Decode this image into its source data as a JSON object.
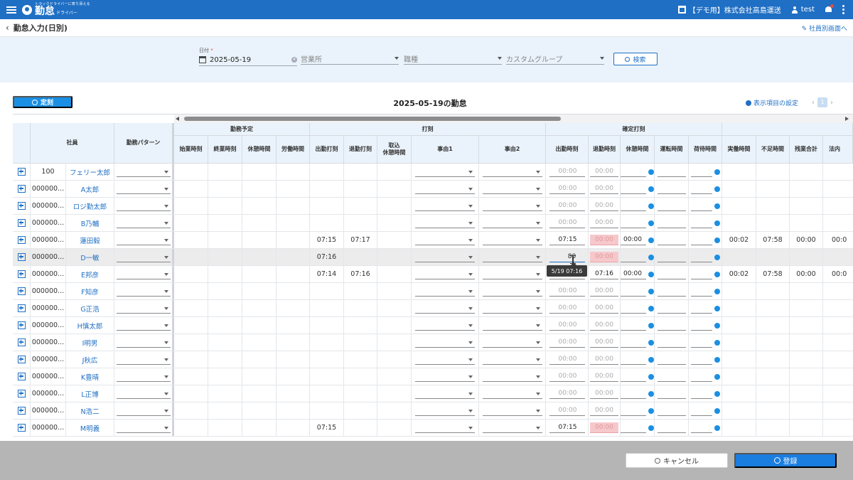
{
  "header": {
    "logo_tagline": "トラックドライバーに寄り添える",
    "logo_main": "勤怠",
    "logo_sub": "ドライバー",
    "company": "【デモ用】株式会社高島運送",
    "user": "test"
  },
  "titlebar": {
    "back": "‹",
    "title": "勤怠入力(日別)",
    "switch_link": "社員別画面へ"
  },
  "filter": {
    "date_label": "日付",
    "date_required": "*",
    "date_value": "2025-05-19",
    "office_placeholder": "営業所",
    "job_placeholder": "職種",
    "group_placeholder": "カスタムグループ",
    "search_label": "検索"
  },
  "toolbar": {
    "teiji_label": "定刻",
    "grid_title": "2025-05-19の勤怠",
    "settings_label": "表示項目の設定",
    "page": "1",
    "prev": "‹",
    "next": "›"
  },
  "columns": {
    "employee": "社員",
    "pattern": "勤務パターン",
    "group_schedule": "勤務予定",
    "group_stamp": "打刻",
    "group_confirmed": "確定打刻",
    "sched_start": "始業時刻",
    "sched_end": "終業時刻",
    "sched_break": "休憩時間",
    "sched_work": "労働時間",
    "stamp_in": "出勤打刻",
    "stamp_out": "退勤打刻",
    "stamp_break": "取込\n休憩時間",
    "reason1": "事由1",
    "reason2": "事由2",
    "conf_in": "出勤時刻",
    "conf_out": "退勤時刻",
    "conf_break": "休憩時間",
    "conf_drive": "運転時間",
    "conf_cargo": "荷待時間",
    "actual": "実働時間",
    "short": "不足時間",
    "overtime": "残業合計",
    "legal": "法内"
  },
  "rows": [
    {
      "id": "100",
      "name": "フェリー太郎",
      "in": "",
      "out": "",
      "c_in": "00:00",
      "c_out": "00:00",
      "c_break": "",
      "err": false,
      "actual": "",
      "short": "",
      "ot": "",
      "legal": ""
    },
    {
      "id": "000000...",
      "name": "A太郎",
      "in": "",
      "out": "",
      "c_in": "00:00",
      "c_out": "00:00",
      "c_break": "",
      "err": false,
      "actual": "",
      "short": "",
      "ot": "",
      "legal": ""
    },
    {
      "id": "000000...",
      "name": "ロジ勤太郎",
      "in": "",
      "out": "",
      "c_in": "00:00",
      "c_out": "00:00",
      "c_break": "",
      "err": false,
      "actual": "",
      "short": "",
      "ot": "",
      "legal": ""
    },
    {
      "id": "000000...",
      "name": "B乃輔",
      "in": "",
      "out": "",
      "c_in": "00:00",
      "c_out": "00:00",
      "c_break": "",
      "err": false,
      "actual": "",
      "short": "",
      "ot": "",
      "legal": ""
    },
    {
      "id": "000000...",
      "name": "蓮田毅",
      "in": "07:15",
      "out": "07:17",
      "c_in": "07:15",
      "c_out": "00:00",
      "c_break": "00:00",
      "err": true,
      "actual": "00:02",
      "short": "07:58",
      "ot": "00:00",
      "legal": "00:0"
    },
    {
      "id": "000000...",
      "name": "D一敏",
      "in": "07:16",
      "out": "",
      "c_in": "80",
      "c_out": "00:00",
      "c_break": "",
      "err": true,
      "active": true,
      "actual": "",
      "short": "",
      "ot": "",
      "legal": ""
    },
    {
      "id": "000000...",
      "name": "E邦彦",
      "in": "07:14",
      "out": "07:16",
      "c_in": "",
      "c_out": "07:16",
      "c_break": "00:00",
      "err": false,
      "out_filled": true,
      "actual": "00:02",
      "short": "07:58",
      "ot": "00:00",
      "legal": "00:0"
    },
    {
      "id": "000000...",
      "name": "F知彦",
      "in": "",
      "out": "",
      "c_in": "00:00",
      "c_out": "00:00",
      "c_break": "",
      "err": false,
      "actual": "",
      "short": "",
      "ot": "",
      "legal": ""
    },
    {
      "id": "000000...",
      "name": "G正浩",
      "in": "",
      "out": "",
      "c_in": "00:00",
      "c_out": "00:00",
      "c_break": "",
      "err": false,
      "actual": "",
      "short": "",
      "ot": "",
      "legal": ""
    },
    {
      "id": "000000...",
      "name": "H慎太郎",
      "in": "",
      "out": "",
      "c_in": "00:00",
      "c_out": "00:00",
      "c_break": "",
      "err": false,
      "actual": "",
      "short": "",
      "ot": "",
      "legal": ""
    },
    {
      "id": "000000...",
      "name": "I明男",
      "in": "",
      "out": "",
      "c_in": "00:00",
      "c_out": "00:00",
      "c_break": "",
      "err": false,
      "actual": "",
      "short": "",
      "ot": "",
      "legal": ""
    },
    {
      "id": "000000...",
      "name": "J秋広",
      "in": "",
      "out": "",
      "c_in": "00:00",
      "c_out": "00:00",
      "c_break": "",
      "err": false,
      "actual": "",
      "short": "",
      "ot": "",
      "legal": ""
    },
    {
      "id": "000000...",
      "name": "K豊晴",
      "in": "",
      "out": "",
      "c_in": "00:00",
      "c_out": "00:00",
      "c_break": "",
      "err": false,
      "actual": "",
      "short": "",
      "ot": "",
      "legal": ""
    },
    {
      "id": "000000...",
      "name": "L正博",
      "in": "",
      "out": "",
      "c_in": "00:00",
      "c_out": "00:00",
      "c_break": "",
      "err": false,
      "actual": "",
      "short": "",
      "ot": "",
      "legal": ""
    },
    {
      "id": "000000...",
      "name": "N浩二",
      "in": "",
      "out": "",
      "c_in": "00:00",
      "c_out": "00:00",
      "c_break": "",
      "err": false,
      "actual": "",
      "short": "",
      "ot": "",
      "legal": ""
    },
    {
      "id": "000000...",
      "name": "M明義",
      "in": "07:15",
      "out": "",
      "c_in": "07:15",
      "c_out": "00:00",
      "c_break": "",
      "err": true,
      "actual": "",
      "short": "",
      "ot": "",
      "legal": ""
    }
  ],
  "tooltip": "5/19 07:16",
  "footer": {
    "cancel": "キャンセル",
    "submit": "登録"
  }
}
